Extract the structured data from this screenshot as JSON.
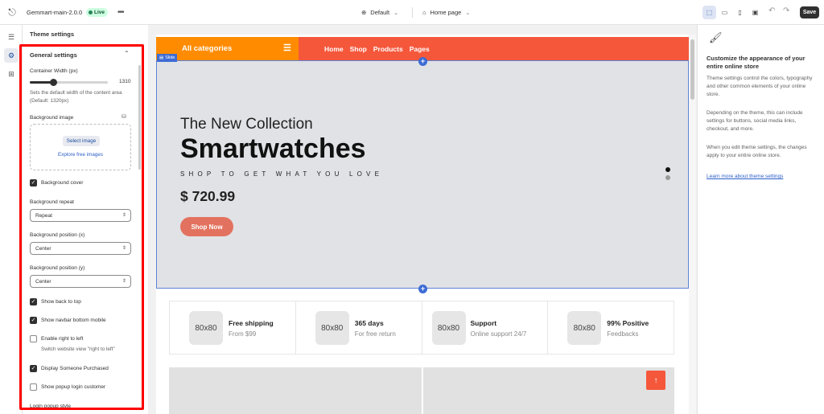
{
  "topbar": {
    "app_name": "Gemmart-main-2.0.0",
    "live_label": "Live",
    "more": "•••",
    "theme_select": "Default",
    "page_select": "Home page",
    "save_label": "Save"
  },
  "panel": {
    "title": "Theme settings",
    "section": "General settings",
    "container_width_label": "Container Width (px)",
    "container_width_value": "1310",
    "container_width_fraction": 0.3,
    "container_width_help": "Sets the default width of the content area (Default: 1320px)",
    "bg_image_label": "Background image",
    "select_image": "Select image",
    "explore_free": "Explore free images",
    "bg_cover_label": "Background cover",
    "bg_repeat_label": "Background repeat",
    "bg_repeat_value": "Repeat",
    "bg_pos_x_label": "Background position (x)",
    "bg_pos_x_value": "Center",
    "bg_pos_y_label": "Background position (y)",
    "bg_pos_y_value": "Center",
    "show_back_to_top": "Show back to top",
    "show_navbar_bottom": "Show navbar bottom mobile",
    "enable_rtl": "Enable right to left",
    "enable_rtl_sub": "Switch website view \"right to left\"",
    "display_someone": "Display Someone Purchased",
    "show_popup_login": "Show popup login customer",
    "login_popup_style": "Login popup style"
  },
  "preview": {
    "all_categories": "All categories",
    "menu": [
      "Home",
      "Shop",
      "Products",
      "Pages"
    ],
    "slide_tag": "Slide",
    "subtitle": "The New Collection",
    "headline": "Smartwatches",
    "tagline": "SHOP TO GET WHAT YOU LOVE",
    "price": "$ 720.99",
    "shop_now": "Shop Now",
    "features": [
      {
        "placeholder": "80x80",
        "title": "Free shipping",
        "sub": "From $99"
      },
      {
        "placeholder": "80x80",
        "title": "365 days",
        "sub": "For free return"
      },
      {
        "placeholder": "80x80",
        "title": "Support",
        "sub": "Online support 24/7"
      },
      {
        "placeholder": "80x80",
        "title": "99% Positive",
        "sub": "Feedbacks"
      }
    ]
  },
  "info": {
    "title": "Customize the appearance of your entire online store",
    "p1": "Theme settings control the colors, typography and other common elements of your online store.",
    "p2": "Depending on the theme, this can include settings for buttons, social media links, checkout, and more.",
    "p3": "When you edit theme settings, the changes apply to your entire online store.",
    "link": "Learn more about theme settings"
  },
  "colors": {
    "nav_red": "#f5573b",
    "nav_orange": "#ff8c00",
    "shop_button": "#e2725f",
    "highlight_box": "#ff0000",
    "selection_blue": "#3d6cd4"
  }
}
